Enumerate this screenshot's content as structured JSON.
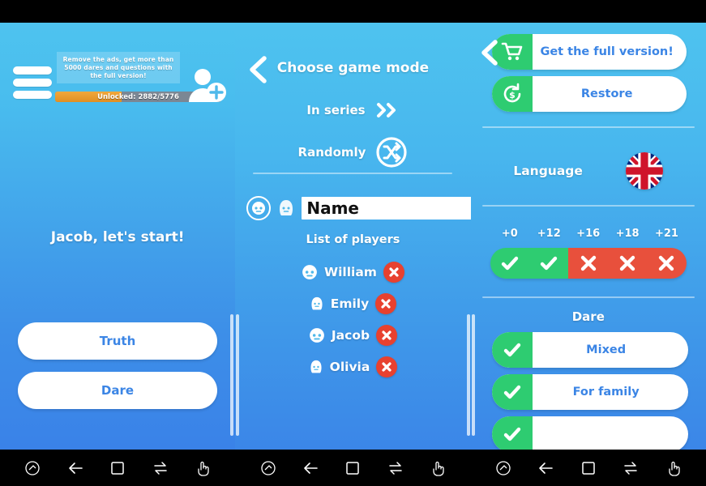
{
  "left_panel": {
    "menu_icon": "hamburger-icon",
    "promo_text": "Remove the ads, get more than 5000 dares and questions with the full version!",
    "progress": {
      "label": "Unlocked: 2882/5776",
      "unlocked": 2882,
      "total": 5776,
      "percent": 40
    },
    "add_user_icon": "add-user-icon",
    "greeting": "Jacob, let's start!",
    "buttons": [
      {
        "label": "Truth",
        "name": "truth-button"
      },
      {
        "label": "Dare",
        "name": "dare-button"
      }
    ]
  },
  "middle_panel": {
    "back_icon": "back-arrow-icon",
    "title": "Choose game mode",
    "modes": [
      {
        "label": "In series",
        "icon": "double-chevron-right-icon"
      },
      {
        "label": "Randomly",
        "icon": "shuffle-icon"
      }
    ],
    "name_input": {
      "value": "Name",
      "placeholder": "Name"
    },
    "gender_selected": "male",
    "add_button_icon": "plus-icon",
    "list_title": "List of players",
    "players": [
      {
        "name": "William",
        "gender": "male"
      },
      {
        "name": "Emily",
        "gender": "female"
      },
      {
        "name": "Jacob",
        "gender": "male"
      },
      {
        "name": "Olivia",
        "gender": "female"
      }
    ],
    "delete_icon": "close-x-icon"
  },
  "right_panel": {
    "back_icon": "back-arrow-icon",
    "store_rows": [
      {
        "label": "Get the full version!",
        "icon": "cart-icon"
      },
      {
        "label": "Restore",
        "icon": "restore-icon"
      }
    ],
    "language_label": "Language",
    "language_flag": "uk-flag-icon",
    "age_ratings": [
      {
        "label": "+0",
        "enabled": true
      },
      {
        "label": "+12",
        "enabled": true
      },
      {
        "label": "+16",
        "enabled": false
      },
      {
        "label": "+18",
        "enabled": false
      },
      {
        "label": "+21",
        "enabled": false
      }
    ],
    "dare_title": "Dare",
    "dare_options": [
      {
        "label": "Mixed",
        "checked": true
      },
      {
        "label": "For family",
        "checked": true
      },
      {
        "label": "",
        "checked": true
      }
    ]
  },
  "navbar": {
    "buttons": [
      {
        "icon": "screenshot-icon"
      },
      {
        "icon": "back-icon"
      },
      {
        "icon": "home-square-icon"
      },
      {
        "icon": "swap-icon"
      },
      {
        "icon": "hand-pointer-icon"
      }
    ]
  },
  "colors": {
    "accent_blue": "#3b85e5",
    "panel_top": "#4ec3ef",
    "panel_bottom": "#3a82e8",
    "green": "#2ecc71",
    "red": "#e8412f",
    "orange": "#e89c2c"
  }
}
